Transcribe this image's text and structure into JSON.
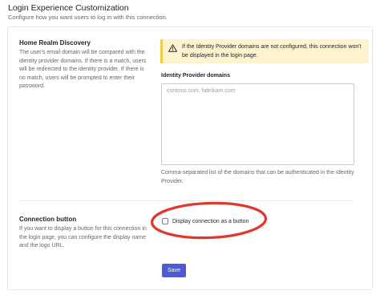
{
  "header": {
    "title": "Login Experience Customization",
    "subtitle": "Configure how you want users to log in with this connection."
  },
  "home_realm": {
    "title": "Home Realm Discovery",
    "description": "The user's email domain will be compared with the identity provider domains. If there is a match, users will be redirected to the identity provider. If there is no match, users will be prompted to enter their password."
  },
  "alert": {
    "icon": "warning-icon",
    "color": "#f2c94c",
    "text": "If the Identity Provider domains are not configured, this connection won't be displayed in the login page."
  },
  "idp_domains": {
    "label": "Identity Provider domains",
    "placeholder": "contoso.com, fabrikam.com",
    "value": "",
    "help": "Comma-separated list of the domains that can be authenticated in the Identity Provider."
  },
  "connection_button": {
    "title": "Connection button",
    "description": "If you want to display a button for this connection in the login page, you can configure the display name and the logo URL.",
    "checkbox_label": "Display connection as a button",
    "checked": false
  },
  "actions": {
    "save_label": "Save",
    "accent": "#4f5bd5"
  },
  "annotation": {
    "color": "#e0382a"
  }
}
